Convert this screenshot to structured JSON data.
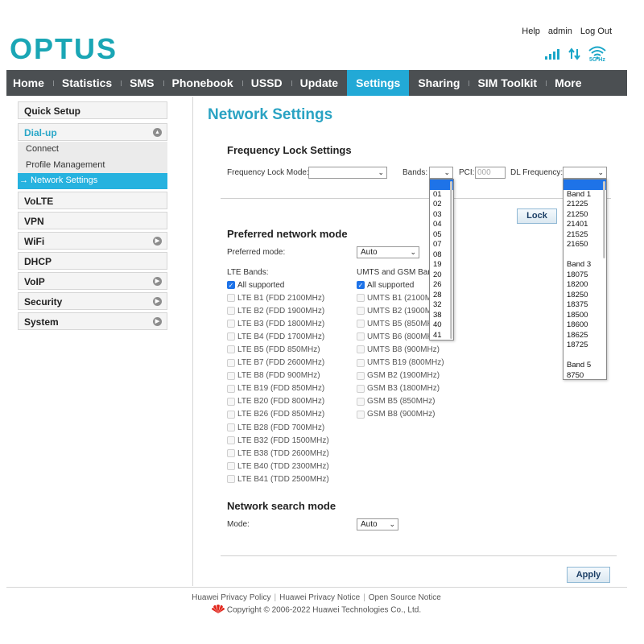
{
  "header": {
    "logo": "OPTUS",
    "top_links": [
      "Help",
      "admin",
      "Log Out"
    ],
    "wifi_band": "5G Hz"
  },
  "nav": {
    "items": [
      "Home",
      "Statistics",
      "SMS",
      "Phonebook",
      "USSD",
      "Update",
      "Settings",
      "Sharing",
      "SIM Toolkit",
      "More"
    ],
    "active": "Settings"
  },
  "sidebar": {
    "quick_setup": "Quick Setup",
    "dialup": "Dial-up",
    "dialup_sub": [
      "Connect",
      "Profile Management",
      "→ Network Settings"
    ],
    "items": [
      "VoLTE",
      "VPN",
      "WiFi",
      "DHCP",
      "VoIP",
      "Security",
      "System"
    ]
  },
  "page_title": "Network Settings",
  "freq_lock": {
    "title": "Frequency Lock Settings",
    "mode_label": "Frequency Lock Mode:",
    "mode_value": "",
    "bands_label": "Bands:",
    "pci_label": "PCI:",
    "pci_placeholder": "000",
    "dl_label": "DL Frequency:",
    "lock_button": "Lock",
    "bands_options": [
      "",
      "01",
      "02",
      "03",
      "04",
      "05",
      "07",
      "08",
      "19",
      "20",
      "26",
      "28",
      "32",
      "38",
      "40",
      "41"
    ],
    "dl_options": [
      "",
      "Band 1",
      "21225",
      "21250",
      "21401",
      "21525",
      "21650",
      "",
      "Band 3",
      "18075",
      "18200",
      "18250",
      "18375",
      "18500",
      "18600",
      "18625",
      "18725",
      "",
      "Band 5",
      "8750"
    ]
  },
  "preferred": {
    "title": "Preferred network mode",
    "mode_label": "Preferred mode:",
    "mode_value": "Auto",
    "lte_header": "LTE Bands:",
    "umts_header": "UMTS and GSM Ban",
    "all_supported": "All supported",
    "lte_bands": [
      "LTE B1 (FDD 2100MHz)",
      "LTE B2 (FDD 1900MHz)",
      "LTE B3 (FDD 1800MHz)",
      "LTE B4 (FDD 1700MHz)",
      "LTE B5 (FDD 850MHz)",
      "LTE B7 (FDD 2600MHz)",
      "LTE B8 (FDD 900MHz)",
      "LTE B19 (FDD 850MHz)",
      "LTE B20 (FDD 800MHz)",
      "LTE B26 (FDD 850MHz)",
      "LTE B28 (FDD 700MHz)",
      "LTE B32 (FDD 1500MHz)",
      "LTE B38 (TDD 2600MHz)",
      "LTE B40 (TDD 2300MHz)",
      "LTE B41 (TDD 2500MHz)"
    ],
    "umts_bands": [
      "UMTS B1 (2100M",
      "UMTS B2 (1900M",
      "UMTS B5 (850MH",
      "UMTS B6 (800MH",
      "UMTS B8 (900MHz)",
      "UMTS B19 (800MHz)",
      "GSM B2 (1900MHz)",
      "GSM B3 (1800MHz)",
      "GSM B5 (850MHz)",
      "GSM B8 (900MHz)"
    ]
  },
  "search": {
    "title": "Network search mode",
    "mode_label": "Mode:",
    "mode_value": "Auto"
  },
  "apply_button": "Apply",
  "footer": {
    "links": [
      "Huawei Privacy Policy",
      "Huawei Privacy Notice",
      "Open Source Notice"
    ],
    "copyright": "Copyright © 2006-2022 Huawei Technologies Co., Ltd."
  },
  "colors": {
    "logo": "#1aa6b5",
    "nav_bg": "#4b4f52",
    "nav_active": "#22a9d6",
    "title": "#2aa3c3",
    "checkbox_on": "#1e73e8"
  }
}
